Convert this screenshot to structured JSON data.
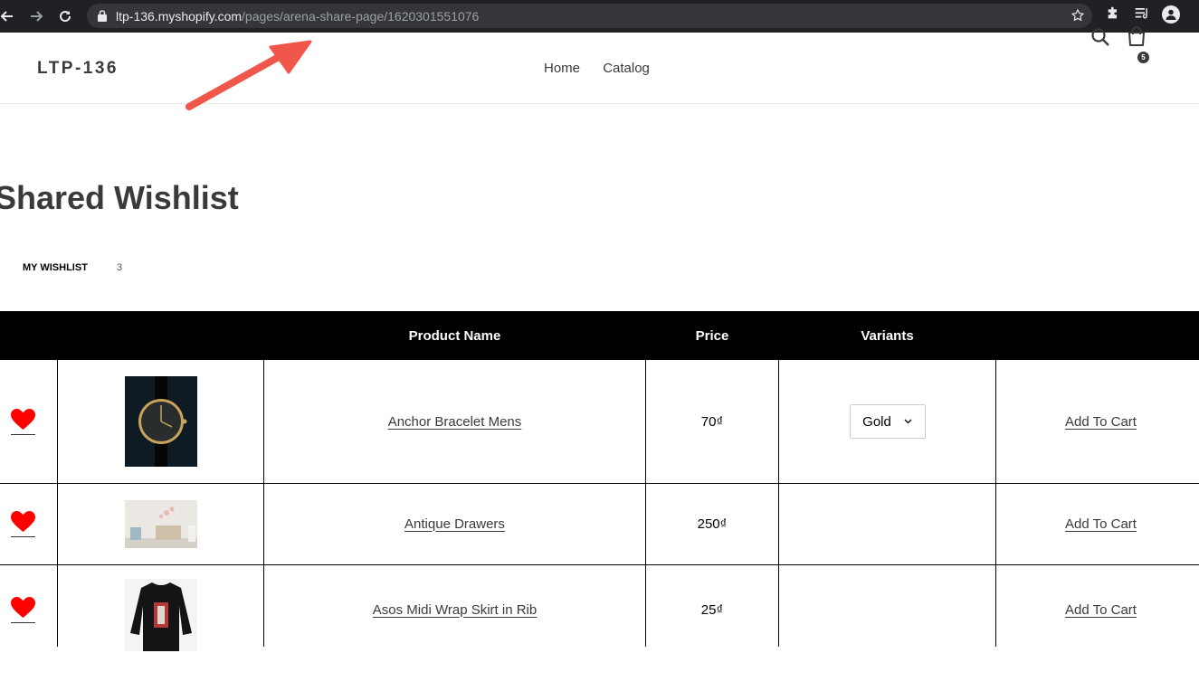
{
  "browser": {
    "url_host": "ltp-136.myshopify.com",
    "url_path": "/pages/arena-share-page/1620301551076"
  },
  "store": {
    "logo": "LTP-136",
    "nav": [
      {
        "label": "Home"
      },
      {
        "label": "Catalog"
      }
    ],
    "cart_count": "5"
  },
  "page": {
    "title": "Shared Wishlist",
    "tab_label": "MY WISHLIST",
    "tab_count": "3"
  },
  "table": {
    "headers": {
      "product_name": "Product Name",
      "price": "Price",
      "variants": "Variants"
    },
    "rows": [
      {
        "name": "Anchor Bracelet Mens",
        "price": "70₫",
        "variant": "Gold",
        "action": "Add To Cart",
        "image": "watch-image"
      },
      {
        "name": "Antique Drawers",
        "price": "250₫",
        "variant": "",
        "action": "Add To Cart",
        "image": "drawers-image"
      },
      {
        "name": "Asos Midi Wrap Skirt in Rib",
        "price": "25₫",
        "variant": "",
        "action": "Add To Cart",
        "image": "sweater-image"
      }
    ]
  },
  "colors": {
    "accent_arrow": "#f0574a",
    "heart": "#ff0000",
    "table_header_bg": "#000000"
  }
}
